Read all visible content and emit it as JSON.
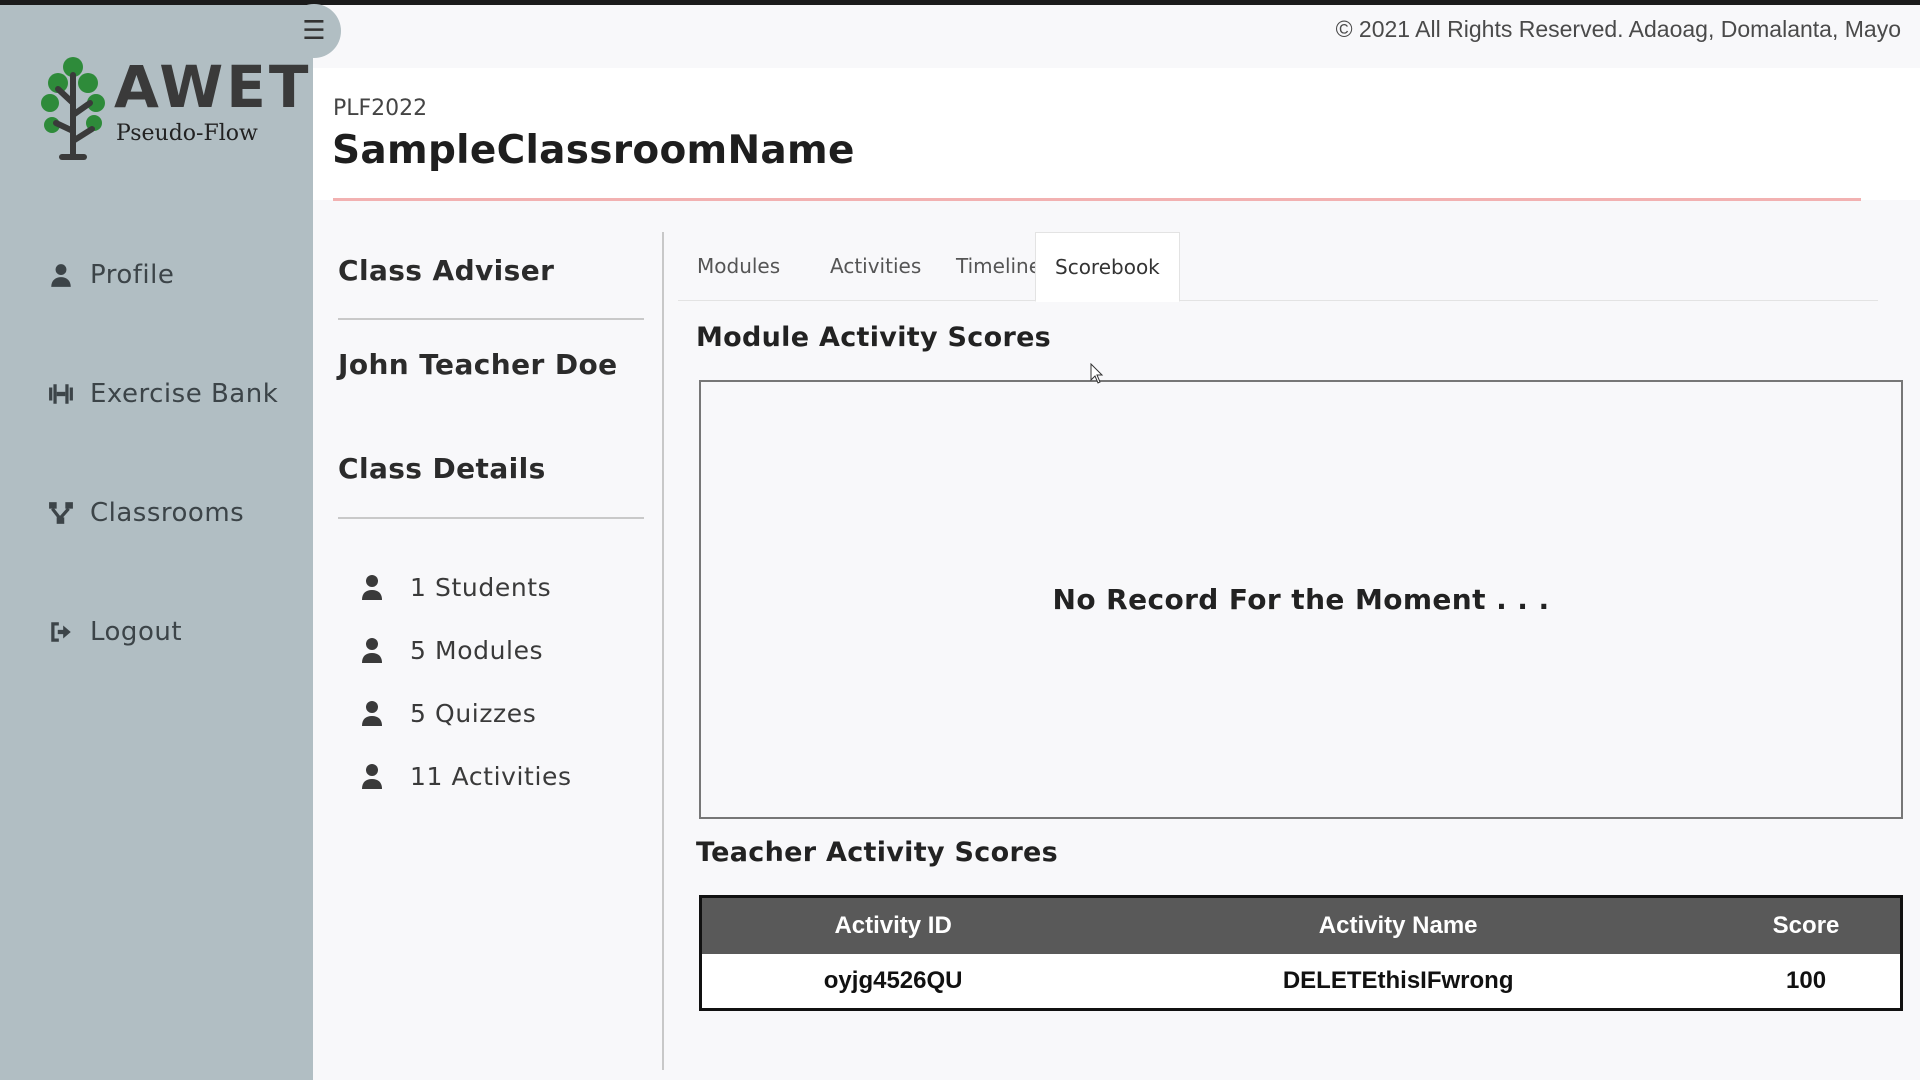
{
  "app": {
    "logo_title": "AWET",
    "logo_subtitle": "Pseudo-Flow",
    "copyright": "© 2021 All Rights Reserved. Adaoag, Domalanta, Mayo"
  },
  "sidebar": {
    "items": [
      {
        "label": "Profile",
        "icon": "user-icon"
      },
      {
        "label": "Exercise Bank",
        "icon": "dumbbell-icon"
      },
      {
        "label": "Classrooms",
        "icon": "network-icon"
      },
      {
        "label": "Logout",
        "icon": "logout-icon"
      }
    ]
  },
  "header": {
    "course_code": "PLF2022",
    "class_name": "SampleClassroomName"
  },
  "info": {
    "adviser_heading": "Class Adviser",
    "adviser_name": "John Teacher Doe",
    "details_heading": "Class Details",
    "stats": [
      "1 Students",
      "5 Modules",
      "5 Quizzes",
      "11 Activities"
    ]
  },
  "tabs": [
    {
      "label": "Modules",
      "active": false
    },
    {
      "label": "Activities",
      "active": false
    },
    {
      "label": "Timeline",
      "active": false
    },
    {
      "label": "Scorebook",
      "active": true
    }
  ],
  "scorebook": {
    "module_heading": "Module Activity Scores",
    "empty_message": "No Record For the Moment . . .",
    "teacher_heading": "Teacher Activity Scores",
    "columns": [
      "Activity ID",
      "Activity Name",
      "Score"
    ],
    "rows": [
      [
        "oyjg4526QU",
        "DELETEthisIFwrong",
        "100"
      ]
    ]
  },
  "colors": {
    "sidebar_bg": "#b1bec3",
    "accent_line": "#f2b1b1",
    "table_header": "#595959"
  }
}
